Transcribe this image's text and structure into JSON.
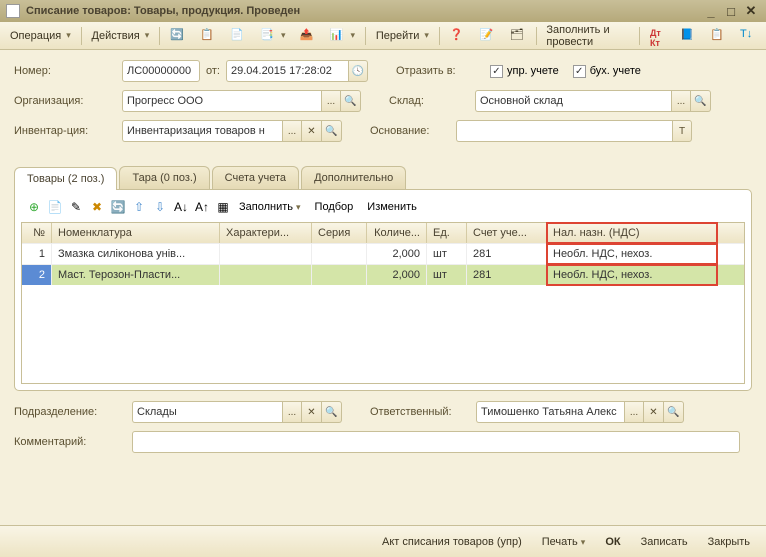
{
  "title": "Списание товаров: Товары, продукция. Проведен",
  "toolbar": {
    "operation": "Операция",
    "actions": "Действия",
    "goto": "Перейти",
    "fillpost": "Заполнить и провести"
  },
  "form": {
    "lbl_number": "Номер:",
    "number": "ЛС00000000",
    "lbl_from": "от:",
    "date": "29.04.2015 17:28:02",
    "lbl_reflect": "Отразить в:",
    "chk_upr": "упр. учете",
    "chk_buh": "бух. учете",
    "lbl_org": "Организация:",
    "org": "Прогресс ООО",
    "lbl_sklad": "Склад:",
    "sklad": "Основной склад",
    "lbl_invent": "Инвентар-ция:",
    "invent": "Инвентаризация товаров н",
    "lbl_osn": "Основание:",
    "osn": ""
  },
  "tabs": {
    "goods": "Товары (2 поз.)",
    "tara": "Тара (0 поз.)",
    "accounts": "Счета учета",
    "extra": "Дополнительно"
  },
  "grid_toolbar": {
    "fill": "Заполнить",
    "select": "Подбор",
    "change": "Изменить"
  },
  "grid": {
    "cols": {
      "n": "№",
      "nom": "Номенклатура",
      "char": "Характери...",
      "ser": "Серия",
      "qty": "Количе...",
      "ed": "Ед.",
      "acc": "Счет уче...",
      "nds": "Нал. назн. (НДС)"
    },
    "rows": [
      {
        "n": "1",
        "nom": "Змазка силіконова унів...",
        "qty": "2,000",
        "ed": "шт",
        "acc": "281",
        "nds": "Необл. НДС, нехоз."
      },
      {
        "n": "2",
        "nom": "Маст. Терозон-Пласти...",
        "qty": "2,000",
        "ed": "шт",
        "acc": "281",
        "nds": "Необл. НДС, нехоз."
      }
    ]
  },
  "footer": {
    "lbl_podr": "Подразделение:",
    "podr": "Склады",
    "lbl_resp": "Ответственный:",
    "resp": "Тимошенко Татьяна Алекс",
    "lbl_comment": "Комментарий:",
    "comment": ""
  },
  "bottom": {
    "act": "Акт списания товаров (упр)",
    "print": "Печать",
    "ok": "ОК",
    "save": "Записать",
    "close": "Закрыть"
  }
}
